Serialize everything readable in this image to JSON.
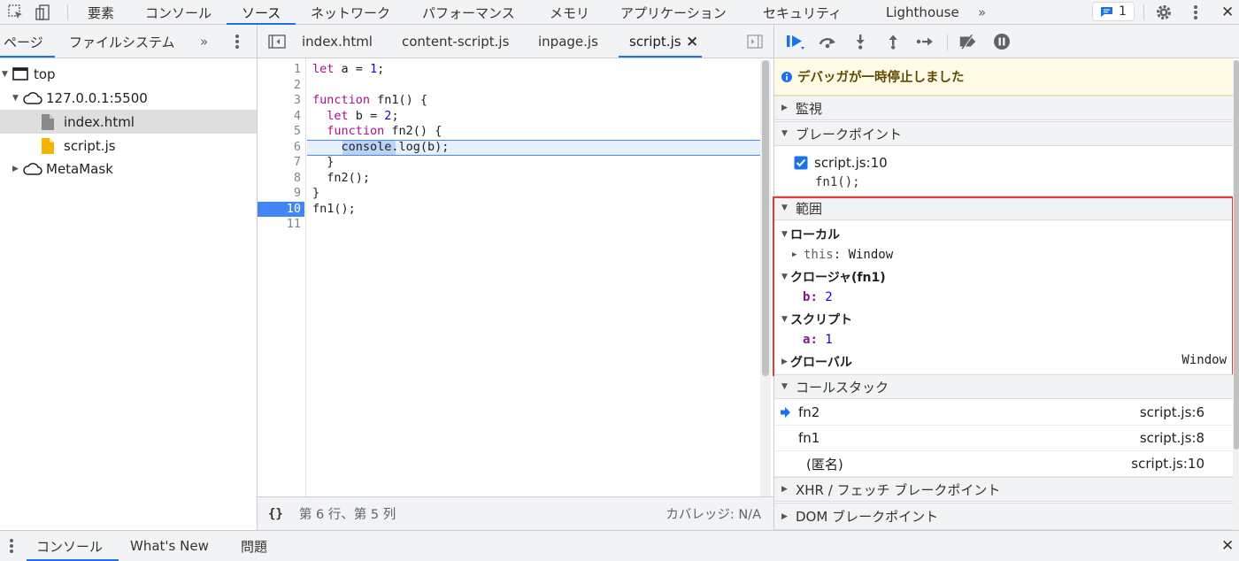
{
  "toolbar": {
    "tabs": [
      "要素",
      "コンソール",
      "ソース",
      "ネットワーク",
      "パフォーマンス",
      "メモリ",
      "アプリケーション",
      "セキュリティ",
      "Lighthouse"
    ],
    "more": "»",
    "issues_count": "1",
    "close": "✕",
    "active_tab": "ソース"
  },
  "navigator": {
    "tabs": [
      "ページ",
      "ファイルシステム"
    ],
    "more": "»",
    "tree": {
      "top": "top",
      "origin": "127.0.0.1:5500",
      "file1": "index.html",
      "file2": "script.js",
      "ext": "MetaMask"
    }
  },
  "editor": {
    "tabs": [
      "index.html",
      "content-script.js",
      "inpage.js",
      "script.js"
    ],
    "active_tab": "script.js",
    "close_glyph": "×",
    "line_numbers": [
      "1",
      "2",
      "3",
      "4",
      "5",
      "6",
      "7",
      "8",
      "9",
      "10",
      "11"
    ],
    "status": {
      "format": "{}",
      "cursor": "第 6 行、第 5 列",
      "coverage": "カバレッジ: N/A"
    }
  },
  "debugger": {
    "paused_message": "デバッガが一時停止しました",
    "sections": {
      "watch": "監視",
      "breakpoints": "ブレークポイント",
      "scope": "範囲",
      "callstack": "コールスタック",
      "xhr": "XHR / フェッチ ブレークポイント",
      "dom": "DOM ブレークポイント"
    },
    "breakpoint": {
      "location": "script.js:10",
      "code": "fn1();"
    },
    "scope": {
      "local": "ローカル",
      "this_key": "this",
      "this_val": "Window",
      "closure": "クロージャ(fn1)",
      "b_key": "b",
      "b_val": "2",
      "script": "スクリプト",
      "a_key": "a",
      "a_val": "1",
      "global": "グローバル",
      "global_val": "Window"
    },
    "callstack": [
      {
        "fn": "fn2",
        "loc": "script.js:6"
      },
      {
        "fn": "fn1",
        "loc": "script.js:8"
      },
      {
        "fn": "(匿名)",
        "loc": "script.js:10"
      }
    ]
  },
  "drawer": {
    "tabs": [
      "コンソール",
      "What's New",
      "問題"
    ],
    "close": "✕"
  }
}
